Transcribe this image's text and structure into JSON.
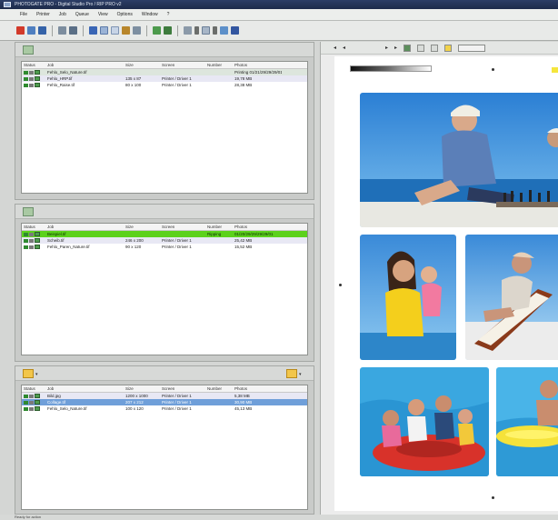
{
  "window": {
    "title": "PHOTOGATE PRO - Digital Studio Pro / RIP PRO v2"
  },
  "menu": [
    "File",
    "Printer",
    "Job",
    "Queue",
    "View",
    "Options",
    "Window",
    "?"
  ],
  "toolbar": {
    "icons": [
      "stop-icon",
      "play-icon",
      "pause-icon",
      "rewind-icon",
      "forward-icon",
      "person-icon",
      "window-icon",
      "layout-icon",
      "film-icon",
      "print-icon",
      "settings-icon",
      "screen-icon",
      "dropdown-icon",
      "image-icon",
      "dropdown-icon",
      "refresh-icon",
      "help-icon"
    ]
  },
  "columns": {
    "status": "Status",
    "job": "Job",
    "size": "Size",
    "screen": "Screen",
    "number": "Number",
    "photos": "Photos"
  },
  "panel1": {
    "rows": [
      {
        "job": "Fehlo_Selo_Nature.tif",
        "size": "",
        "screen": "",
        "number": "",
        "photos": "Printing 01/21/29/29/29/01",
        "state": "printing"
      },
      {
        "job": "Fehlo_HRP.tif",
        "size": "135 x 87",
        "screen": "Printer / Driver 1",
        "number": "",
        "photos": "19,78 MB",
        "state": "alt"
      },
      {
        "job": "Fehlo_Raise.tif",
        "size": "80 x 100",
        "screen": "Printer / Driver 1",
        "number": "",
        "photos": "28,38 MB",
        "state": "normal"
      }
    ]
  },
  "panel2": {
    "rows": [
      {
        "job": "Beispiel.tif",
        "size": "",
        "screen": "",
        "number": "Ripping",
        "photos": "01/20/29/29/29/29/01",
        "state": "ripping"
      },
      {
        "job": "Scheib.tif",
        "size": "246 x 200",
        "screen": "Printer / Driver 1",
        "number": "",
        "photos": "25,42 MB",
        "state": "alt"
      },
      {
        "job": "Fehlo_Paren_Nature.tif",
        "size": "90 x 120",
        "screen": "Printer / Driver 1",
        "number": "",
        "photos": "15,52 MB",
        "state": "normal"
      }
    ]
  },
  "panel3": {
    "rows": [
      {
        "job": "Bild.jpg",
        "size": "1200 x 1000",
        "screen": "Printer / Driver 1",
        "number": "",
        "photos": "5,38 MB",
        "state": "alt"
      },
      {
        "job": "Collage.tif",
        "size": "207 x 212",
        "screen": "Printer / Driver 1",
        "number": "",
        "photos": "30,90 MB",
        "state": "selected"
      },
      {
        "job": "Fehlo_Selo_Nature.tif",
        "size": "100 x 120",
        "screen": "Printer / Driver 1",
        "number": "",
        "photos": "45,13 MB",
        "state": "normal"
      }
    ]
  },
  "preview": {
    "photos": [
      "man-playing-chess-by-pool-photo",
      "mother-and-child-in-yellow-swimsuit-photo",
      "woman-in-deck-chair-photo",
      "family-on-inflatable-ring-photo",
      "child-with-float-photo"
    ]
  },
  "statusbar": {
    "text": "Ready for action"
  },
  "colors": {
    "ripping": "#5cd11c",
    "selected": "#6f9fd9",
    "titlebar": "#243458"
  }
}
